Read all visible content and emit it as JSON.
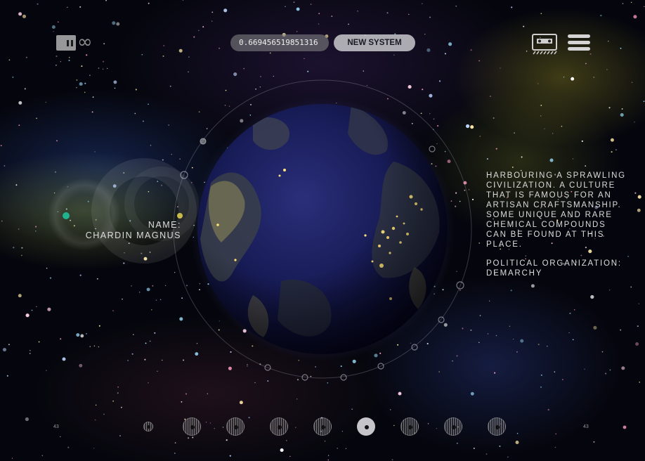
{
  "toolbar": {
    "seed_value": "0.669456519851316",
    "new_system_label": "NEW SYSTEM"
  },
  "icons": {
    "logo": "pause-infinity-logo",
    "right": [
      "cassette-icon",
      "hamburger-menu-icon"
    ]
  },
  "planet": {
    "name_label": "NAME:",
    "name_value": "CHARDIN MAGNUS",
    "description": "HARBOURING A SPRAWLING CIVILIZATION. A CULTURE THAT IS FAMOUS FOR AN ARTISAN CRAFTSMANSHIP. SOME UNIQUE AND RARE CHEMICAL COMPOUNDS CAN BE FOUND AT THIS PLACE.",
    "political_label": "POLITICAL ORGANIZATION:",
    "political_value": "DEMARCHY"
  },
  "bottom_nav": {
    "left_number": "43",
    "right_number": "43",
    "planet_count": 9,
    "active_index": 4
  },
  "colors": {
    "planet_ocean": "#1a1f5c",
    "city_lights": "#ffe27a",
    "button_light": "#c8c8cd",
    "text": "#dcdcdc"
  }
}
